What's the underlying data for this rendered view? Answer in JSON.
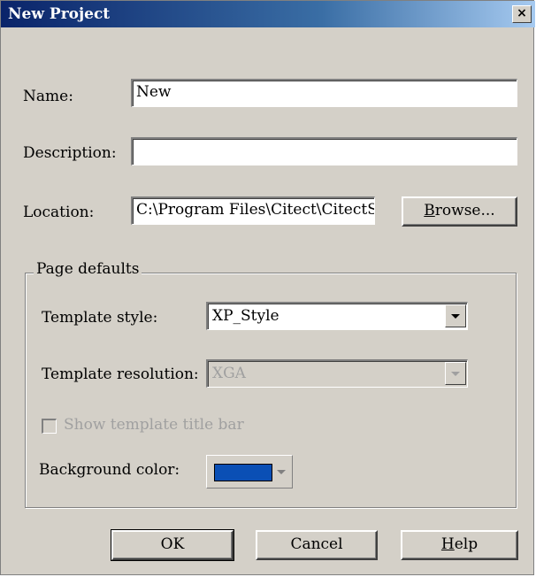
{
  "window": {
    "title": "New Project",
    "close_label": "×"
  },
  "form": {
    "name_label": "Name:",
    "name_value": "New",
    "description_label": "Description:",
    "description_value": "",
    "location_label": "Location:",
    "location_value": "C:\\Program Files\\Citect\\CitectS(",
    "browse_label_rest": "rowse...",
    "browse_mnemonic": "B"
  },
  "page_defaults": {
    "legend": "Page defaults",
    "template_style_label": "Template style:",
    "template_style_value": "XP_Style",
    "template_resolution_label": "Template resolution:",
    "template_resolution_value": "XGA",
    "show_title_bar_label": "Show template title bar",
    "show_title_bar_checked": false,
    "background_color_label": "Background color:",
    "background_color": "#0a4fb5"
  },
  "buttons": {
    "ok": "OK",
    "cancel": "Cancel",
    "help_mnemonic": "H",
    "help_rest": "elp"
  },
  "colors": {
    "dialog_bg": "#d4d0c8",
    "titlebar_start": "#0a246a",
    "titlebar_end": "#a6caf0"
  },
  "icons": {
    "close": "close-icon",
    "dropdown": "chevron-down-icon"
  }
}
